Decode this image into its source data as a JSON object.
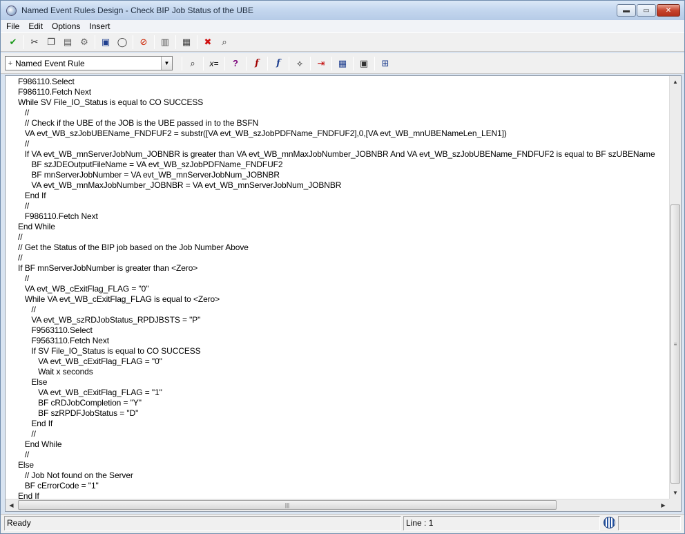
{
  "window": {
    "title": "Named Event Rules Design - Check BIP Job Status of the UBE",
    "controls": {
      "minimize": "▬",
      "maximize": "▭",
      "close": "✕"
    }
  },
  "menu": [
    "File",
    "Edit",
    "Options",
    "Insert"
  ],
  "toolbar1": [
    {
      "name": "ok-check-icon",
      "glyph": "✔",
      "color": "#1e9b1e"
    },
    {
      "name": "cut-icon",
      "glyph": "✂",
      "color": "#333333"
    },
    {
      "name": "copy-icon",
      "glyph": "❐",
      "color": "#333333"
    },
    {
      "name": "paste-icon",
      "glyph": "▤",
      "color": "#555555"
    },
    {
      "name": "settings-icon",
      "glyph": "⚙",
      "color": "#666666"
    },
    {
      "name": "save-icon",
      "glyph": "▣",
      "color": "#1f3f8f"
    },
    {
      "name": "comment-bubble-icon",
      "glyph": "◯",
      "color": "#333333"
    },
    {
      "name": "disable-icon",
      "glyph": "⊘",
      "color": "#cc2200"
    },
    {
      "name": "delete-trash-icon",
      "glyph": "▥",
      "color": "#555555"
    },
    {
      "name": "print-icon",
      "glyph": "▦",
      "color": "#444444"
    },
    {
      "name": "cancel-x-icon",
      "glyph": "✖",
      "color": "#d01010"
    },
    {
      "name": "find-icon",
      "glyph": "⌕",
      "color": "#333333"
    }
  ],
  "toolbar2": {
    "dropdown": {
      "prefix": "+",
      "value": "Named Event Rule"
    },
    "buttons": [
      {
        "name": "search-icon",
        "glyph": "⌕",
        "color": "#333333"
      },
      {
        "name": "assign-icon",
        "glyph": "x=",
        "color": "#000000"
      },
      {
        "name": "if-while-icon",
        "glyph": "?",
        "color": "#7a007a"
      },
      {
        "name": "business-function-icon",
        "glyph": "f",
        "color": "#a00000"
      },
      {
        "name": "system-function-icon",
        "glyph": "f",
        "color": "#1f3f8f"
      },
      {
        "name": "file-io-icon",
        "glyph": "⟡",
        "color": "#333333"
      },
      {
        "name": "indent-icon",
        "glyph": "⇥",
        "color": "#c00000"
      },
      {
        "name": "table-io-icon",
        "glyph": "▦",
        "color": "#1f3f8f"
      },
      {
        "name": "form-interconnect-icon",
        "glyph": "▣",
        "color": "#333333"
      },
      {
        "name": "report-interconnect-icon",
        "glyph": "⊞",
        "color": "#1f3f8f"
      }
    ]
  },
  "code_lines": [
    "F986110.Select",
    "F986110.Fetch Next",
    "While SV File_IO_Status is equal to CO SUCCESS",
    "   //",
    "   // Check if the UBE of the JOB is the UBE passed in to the BSFN",
    "   VA evt_WB_szJobUBEName_FNDFUF2 = substr([VA evt_WB_szJobPDFName_FNDFUF2],0,[VA evt_WB_mnUBENameLen_LEN1])",
    "   //",
    "   If VA evt_WB_mnServerJobNum_JOBNBR is greater than VA evt_WB_mnMaxJobNumber_JOBNBR And VA evt_WB_szJobUBEName_FNDFUF2 is equal to BF szUBEName",
    "      BF szJDEOutputFileName = VA evt_WB_szJobPDFName_FNDFUF2",
    "      BF mnServerJobNumber = VA evt_WB_mnServerJobNum_JOBNBR",
    "      VA evt_WB_mnMaxJobNumber_JOBNBR = VA evt_WB_mnServerJobNum_JOBNBR",
    "   End If",
    "   //",
    "   F986110.Fetch Next",
    "End While",
    "//",
    "// Get the Status of the BIP job based on the Job Number Above",
    "//",
    "If BF mnServerJobNumber is greater than <Zero>",
    "   //",
    "   VA evt_WB_cExitFlag_FLAG = \"0\"",
    "   While VA evt_WB_cExitFlag_FLAG is equal to <Zero>",
    "      //",
    "      VA evt_WB_szRDJobStatus_RPDJBSTS = \"P\"",
    "      F9563110.Select",
    "      F9563110.Fetch Next",
    "      If SV File_IO_Status is equal to CO SUCCESS",
    "         VA evt_WB_cExitFlag_FLAG = \"0\"",
    "         Wait x seconds",
    "      Else",
    "         VA evt_WB_cExitFlag_FLAG = \"1\"",
    "         BF cRDJobCompletion = \"Y\"",
    "         BF szRPDFJobStatus = \"D\"",
    "      End If",
    "      //",
    "   End While",
    "   //",
    "Else",
    "   // Job Not found on the Server",
    "   BF cErrorCode = \"1\"",
    "End If"
  ],
  "scrollbars": {
    "up": "▲",
    "down": "▼",
    "left": "◀",
    "right": "▶",
    "grip_v": "≡",
    "grip_h": "|||"
  },
  "status": {
    "ready": "Ready",
    "line": "Line :   1"
  }
}
